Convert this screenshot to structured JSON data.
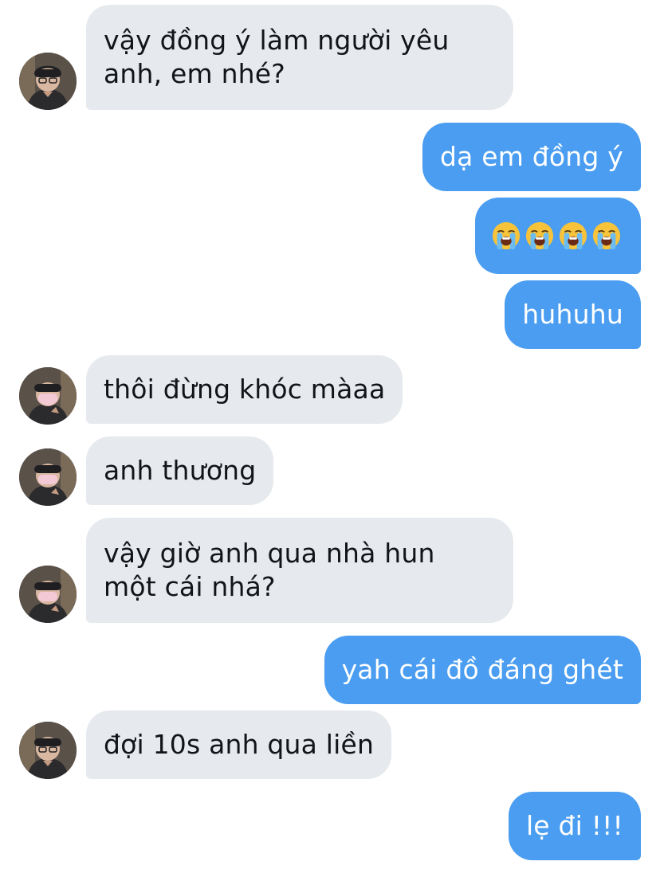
{
  "conversation": {
    "messages": [
      {
        "from": "them",
        "lines": [
          "vậy đồng ý làm người yêu",
          "anh, em nhé?"
        ]
      },
      {
        "from": "me",
        "text": "dạ em đồng ý"
      },
      {
        "from": "me",
        "emoji": "loudly-crying-face",
        "emoji_count": 4
      },
      {
        "from": "me",
        "text": "huhuhu"
      },
      {
        "from": "them",
        "text": "thôi đừng khóc màaa"
      },
      {
        "from": "them",
        "text": "anh thương"
      },
      {
        "from": "them",
        "lines": [
          "vậy giờ anh qua nhà hun",
          "một cái nhá?"
        ]
      },
      {
        "from": "me",
        "text": "yah cái đồ đáng ghét"
      },
      {
        "from": "them",
        "text": "đợi 10s anh qua liền"
      },
      {
        "from": "me",
        "text": "lẹ đi !!!"
      }
    ]
  },
  "colors": {
    "sent_bubble": "#4a9df0",
    "received_bubble": "#e6e9ed",
    "sent_text": "#ffffff",
    "received_text": "#111418"
  },
  "icons": {
    "avatar": "contact-avatar-photo",
    "emoji": "loudly-crying-face-emoji"
  }
}
